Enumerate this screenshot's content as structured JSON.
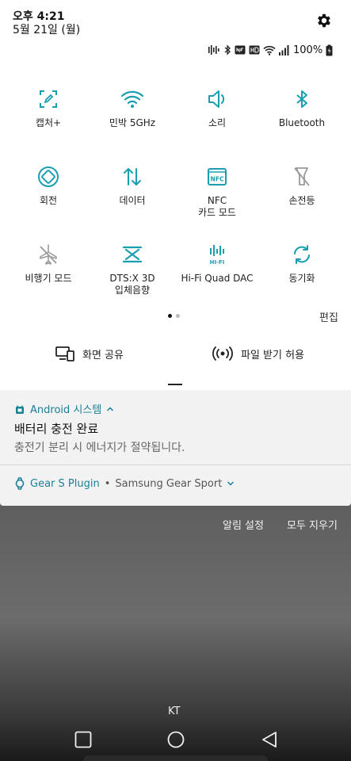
{
  "status": {
    "time": "오후 4:21",
    "date": "5월 21일 (월)",
    "battery": "100%"
  },
  "tiles": [
    {
      "label": "캡처+",
      "icon": "capture-icon",
      "active": true
    },
    {
      "label": "민박 5GHz",
      "icon": "wifi-icon",
      "active": true
    },
    {
      "label": "소리",
      "icon": "sound-icon",
      "active": true
    },
    {
      "label": "Bluetooth",
      "icon": "bluetooth-icon",
      "active": true
    },
    {
      "label": "회전",
      "icon": "rotate-icon",
      "active": true
    },
    {
      "label": "데이터",
      "icon": "data-icon",
      "active": true
    },
    {
      "label": "NFC\n카드 모드",
      "icon": "nfc-icon",
      "active": true
    },
    {
      "label": "손전등",
      "icon": "flashlight-icon",
      "active": false
    },
    {
      "label": "비행기 모드",
      "icon": "airplane-icon",
      "active": false
    },
    {
      "label": "DTS:X 3D\n입체음향",
      "icon": "dtsx-icon",
      "active": true
    },
    {
      "label": "Hi-Fi Quad DAC",
      "icon": "hifi-icon",
      "active": true
    },
    {
      "label": "동기화",
      "icon": "sync-icon",
      "active": true
    }
  ],
  "edit_label": "편집",
  "share": {
    "screen_share": "화면 공유",
    "file_receive": "파일 받기 허용"
  },
  "notifications": {
    "first": {
      "app": "Android 시스템",
      "title": "배터리 충전 완료",
      "text": "충전기 분리 시 에너지가 절약됩니다."
    },
    "second": {
      "app": "Gear S Plugin",
      "sub": "Samsung Gear Sport"
    }
  },
  "actions": {
    "settings": "알림 설정",
    "clear_all": "모두 지우기"
  },
  "carrier": "KT",
  "colors": {
    "accent": "#1a9fb0",
    "inactive": "#9a9a9a"
  }
}
